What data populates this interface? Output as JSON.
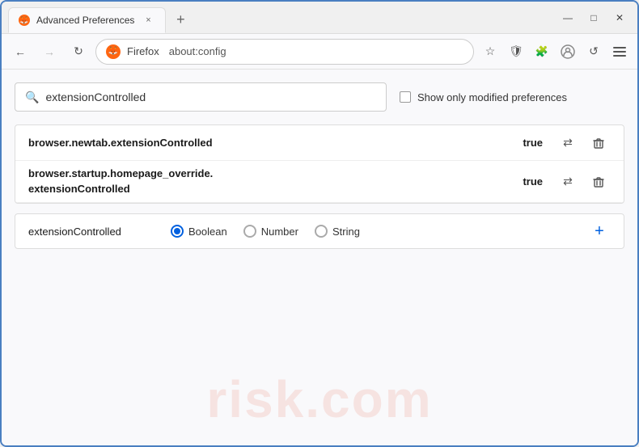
{
  "window": {
    "title": "Advanced Preferences",
    "tab_close": "×",
    "tab_new": "+",
    "btn_minimize": "—",
    "btn_maximize": "□",
    "btn_close": "✕"
  },
  "navbar": {
    "back": "←",
    "forward": "→",
    "refresh": "↻",
    "browser_label": "Firefox",
    "url": "about:config",
    "bookmark_icon": "☆",
    "shield_icon": "🛡",
    "extension_icon": "🧩",
    "menu_icon": "≡"
  },
  "search": {
    "placeholder": "extensionControlled",
    "value": "extensionControlled",
    "checkbox_label": "Show only modified preferences"
  },
  "results": [
    {
      "name": "browser.newtab.extensionControlled",
      "value": "true"
    },
    {
      "name_line1": "browser.startup.homepage_override.",
      "name_line2": "extensionControlled",
      "value": "true"
    }
  ],
  "add_preference": {
    "name": "extensionControlled",
    "type_options": [
      "Boolean",
      "Number",
      "String"
    ],
    "selected_type": "Boolean"
  },
  "watermark": "risk.com",
  "icons": {
    "search": "🔍",
    "swap": "⇄",
    "trash": "🗑",
    "plus": "+",
    "radio_boolean_selected": true,
    "radio_number_selected": false,
    "radio_string_selected": false
  }
}
